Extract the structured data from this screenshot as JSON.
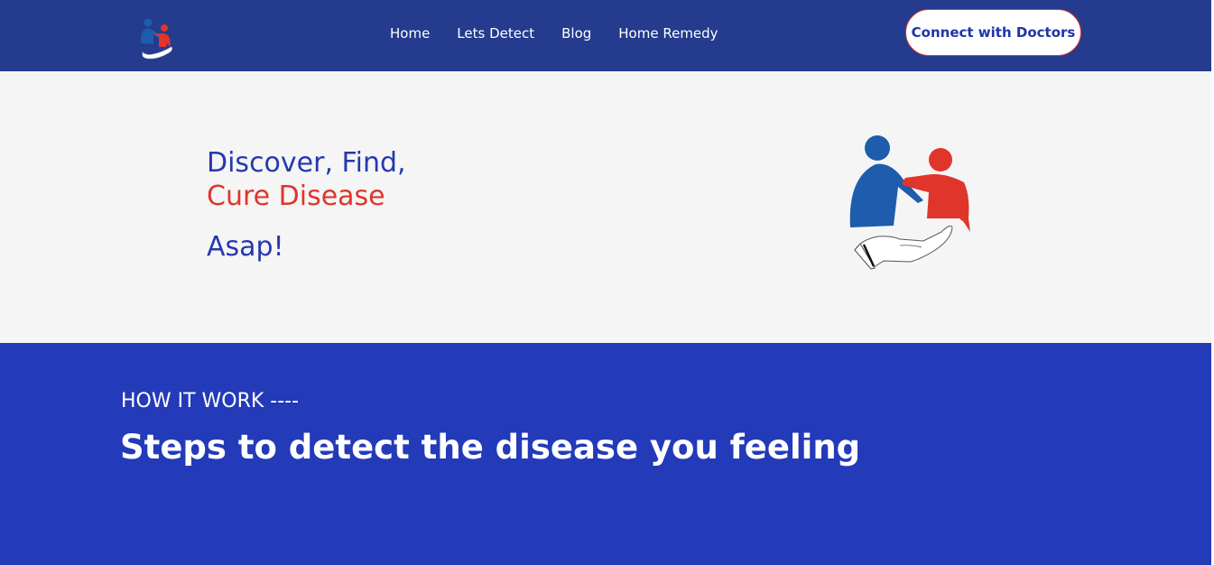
{
  "header": {
    "logo_icon": "caring-people-logo-icon",
    "nav": [
      {
        "label": "Home"
      },
      {
        "label": "Lets Detect"
      },
      {
        "label": "Blog"
      },
      {
        "label": "Home Remedy"
      }
    ],
    "cta_label": "Connect with Doctors"
  },
  "hero": {
    "line1": "Discover, Find,",
    "line2": "Cure Disease",
    "line3": "Asap!",
    "illustration_icon": "caring-people-hand-illustration"
  },
  "how_it_works": {
    "eyebrow": "HOW IT WORK ----",
    "title": "Steps to detect the disease you feeling"
  },
  "colors": {
    "nav_bg": "#243b8e",
    "hero_bg": "#f5f5f5",
    "section_bg": "#233ab9",
    "brand_blue": "#2639ae",
    "brand_red": "#e0352b"
  }
}
